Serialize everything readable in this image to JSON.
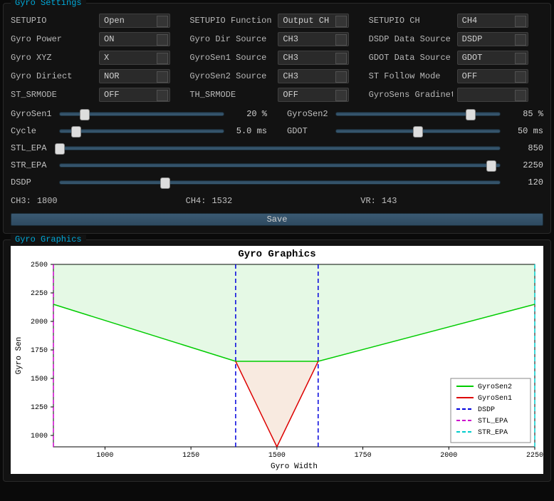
{
  "panels": {
    "settings_title": "Gyro Settings",
    "graphics_title": "Gyro Graphics"
  },
  "dropdowns": {
    "row1": {
      "setupio_label": "SETUPIO",
      "setupio_val": "Open",
      "setupio_fn_label": "SETUPIO Function",
      "setupio_fn_val": "Output CH",
      "setupio_ch_label": "SETUPIO CH",
      "setupio_ch_val": "CH4"
    },
    "row2": {
      "power_label": "Gyro Power",
      "power_val": "ON",
      "dir_src_label": "Gyro Dir Source",
      "dir_src_val": "CH3",
      "dsdp_src_label": "DSDP Data Source",
      "dsdp_src_val": "DSDP"
    },
    "row3": {
      "xyz_label": "Gyro XYZ",
      "xyz_val": "X",
      "sen1_src_label": "GyroSen1 Source",
      "sen1_src_val": "CH3",
      "gdot_src_label": "GDOT Data Source",
      "gdot_src_val": "GDOT"
    },
    "row4": {
      "direct_label": "Gyro Diriect",
      "direct_val": "NOR",
      "sen2_src_label": "GyroSen2 Source",
      "sen2_src_val": "CH3",
      "follow_label": "ST Follow Mode",
      "follow_val": "OFF"
    },
    "row5": {
      "st_sr_label": "ST_SRMODE",
      "st_sr_val": "OFF",
      "th_sr_label": "TH_SRMODE",
      "th_sr_val": "OFF",
      "grad_label": "GyroSens Gradinet",
      "grad_val": ""
    }
  },
  "sliders": {
    "sen1_label": "GyroSen1",
    "sen1_val": "20 %",
    "sen1_pct": 15,
    "sen2_label": "GyroSen2",
    "sen2_val": "85 %",
    "sen2_pct": 82,
    "cycle_label": "Cycle",
    "cycle_val": "5.0 ms",
    "cycle_pct": 10,
    "gdot_label": "GDOT",
    "gdot_val": "50 ms",
    "gdot_pct": 50,
    "stl_label": "STL_EPA",
    "stl_val": "850",
    "stl_pct": 0,
    "str_label": "STR_EPA",
    "str_val": "2250",
    "str_pct": 98,
    "dsdp_label": "DSDP",
    "dsdp_val": "120",
    "dsdp_pct": 24
  },
  "readouts": {
    "ch3_label": "CH3:",
    "ch3_val": "1800",
    "ch4_label": "CH4:",
    "ch4_val": "1532",
    "vr_label": "VR:",
    "vr_val": "143"
  },
  "save_label": "Save",
  "chart": {
    "title": "Gyro Graphics",
    "xlabel": "Gyro Width",
    "ylabel": "Gyro Sen",
    "legend": [
      "GyroSen2",
      "GyroSen1",
      "DSDP",
      "STL_EPA",
      "STR_EPA"
    ]
  },
  "chart_data": {
    "type": "line",
    "xlabel": "Gyro Width",
    "ylabel": "Gyro Sen",
    "title": "Gyro Graphics",
    "xlim": [
      850,
      2250
    ],
    "ylim": [
      900,
      2500
    ],
    "xticks": [
      1000,
      1250,
      1500,
      1750,
      2000,
      2250
    ],
    "yticks": [
      1000,
      1250,
      1500,
      1750,
      2000,
      2250,
      2500
    ],
    "vlines": {
      "DSDP": [
        1380,
        1620
      ],
      "STL_EPA": [
        850
      ],
      "STR_EPA": [
        2250
      ]
    },
    "series": [
      {
        "name": "GyroSen2",
        "color": "#00cc00",
        "x": [
          850,
          1380,
          1620,
          2250
        ],
        "y": [
          2150,
          1650,
          1650,
          2150
        ]
      },
      {
        "name": "GyroSen1",
        "color": "#dd0000",
        "x": [
          1380,
          1500,
          1620
        ],
        "y": [
          1650,
          900,
          1650
        ]
      }
    ]
  }
}
